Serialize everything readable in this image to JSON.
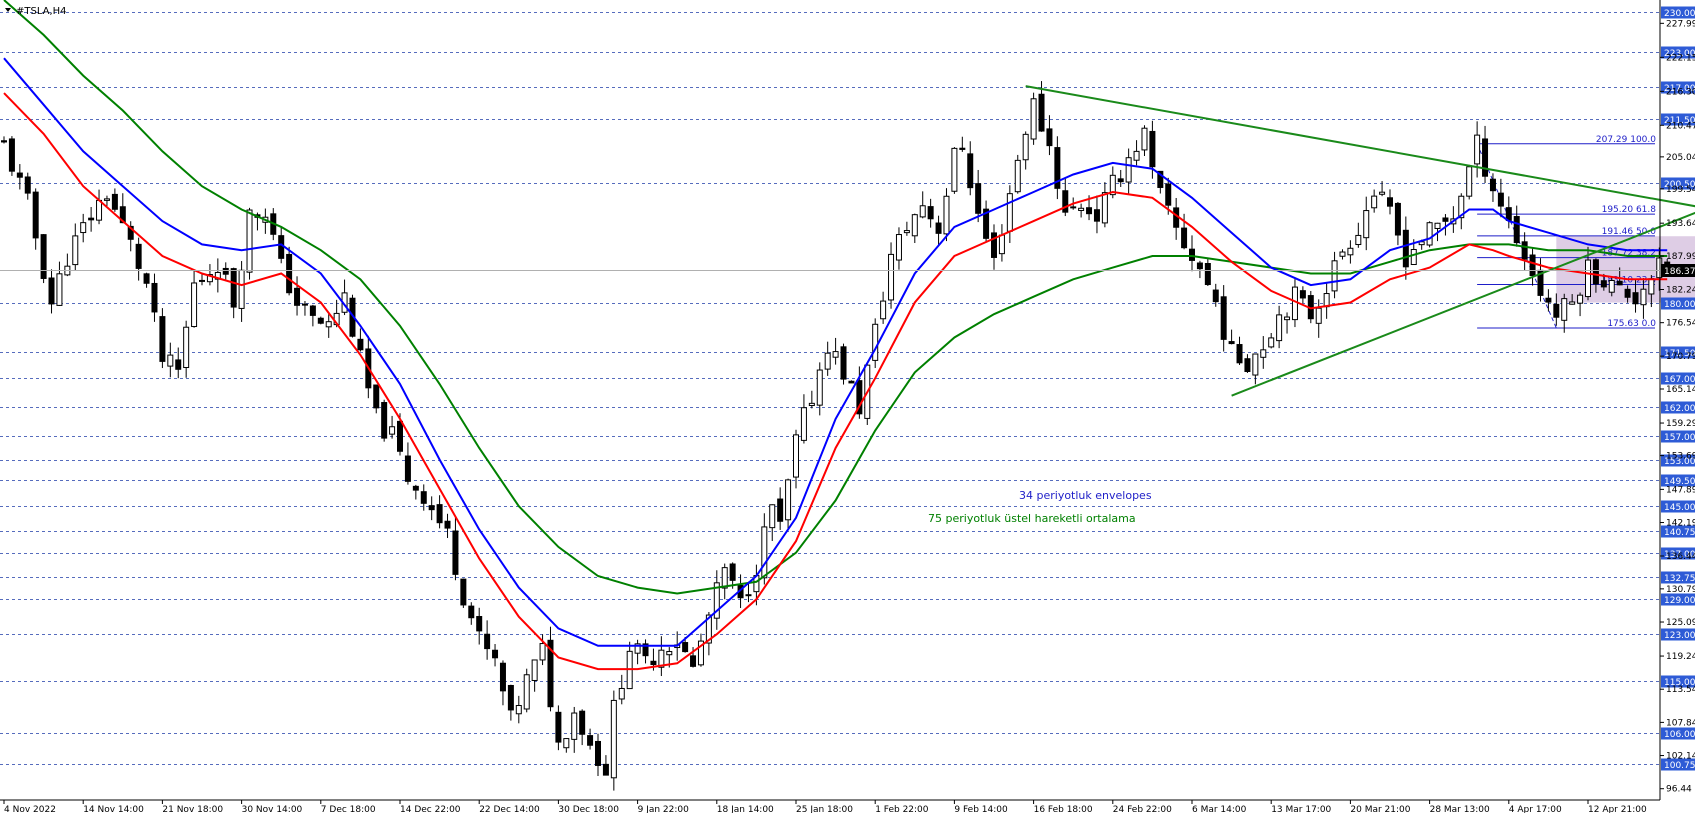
{
  "window": {
    "title": "#TSLA,H4",
    "menu_icon": "triangle-down-icon"
  },
  "price_label": "186.37",
  "annotations": {
    "envelopes": "34 periyotluk envelopes",
    "ema": "75 periyotluk üstel hareketli ortalama"
  },
  "colors": {
    "background": "#ffffff",
    "grid": "#1e3ca8",
    "axis_box": "#2e5bd6",
    "envelope_upper": "#0000ff",
    "envelope_lower": "#ff0000",
    "ema": "#008000",
    "trendline": "#1a8a1a",
    "fibo": "#1e1ec8",
    "rectangle": "#d8c4e0",
    "candles": "#000000"
  },
  "chart_data": {
    "type": "candlestick",
    "symbol": "#TSLA",
    "timeframe": "H4",
    "ylim": [
      94.5,
      232.0
    ],
    "y_ticks": [
      227.99,
      222.15,
      216.3,
      210.47,
      205.04,
      199.54,
      193.64,
      187.99,
      182.24,
      176.54,
      170.79,
      165.14,
      159.29,
      153.69,
      147.89,
      142.19,
      136.44,
      130.79,
      125.09,
      119.24,
      113.54,
      107.84,
      102.14,
      96.44
    ],
    "level_lines": [
      "230.00",
      "223.00",
      "217.00",
      "211.50",
      "200.50",
      "180.00",
      "171.50",
      "167.00",
      "162.00",
      "157.00",
      "153.00",
      "149.50",
      "145.00",
      "140.75",
      "137.00",
      "132.75",
      "129.00",
      "123.00",
      "115.00",
      "106.00",
      "100.75"
    ],
    "x_tick_labels": [
      "4 Nov 2022",
      "14 Nov 14:00",
      "21 Nov 18:00",
      "30 Nov 14:00",
      "7 Dec 18:00",
      "14 Dec 22:00",
      "22 Dec 14:00",
      "30 Dec 18:00",
      "9 Jan 22:00",
      "18 Jan 14:00",
      "25 Jan 18:00",
      "1 Feb 22:00",
      "9 Feb 14:00",
      "16 Feb 18:00",
      "24 Feb 22:00",
      "6 Mar 14:00",
      "13 Mar 17:00",
      "20 Mar 21:00",
      "28 Mar 13:00",
      "4 Apr 17:00",
      "12 Apr 21:00"
    ],
    "x_tick_index": [
      0,
      10,
      20,
      30,
      40,
      50,
      60,
      70,
      80,
      90,
      100,
      110,
      120,
      130,
      140,
      150,
      160,
      170,
      180,
      190,
      200
    ],
    "close_path": [
      [
        0,
        207
      ],
      [
        3,
        197
      ],
      [
        6,
        180
      ],
      [
        8,
        188
      ],
      [
        11,
        195
      ],
      [
        13,
        199
      ],
      [
        16,
        190
      ],
      [
        18,
        183
      ],
      [
        20,
        170
      ],
      [
        22,
        168
      ],
      [
        24,
        183
      ],
      [
        27,
        187
      ],
      [
        29,
        180
      ],
      [
        31,
        195
      ],
      [
        33,
        196
      ],
      [
        35,
        186
      ],
      [
        37,
        180
      ],
      [
        39,
        177
      ],
      [
        41,
        176
      ],
      [
        43,
        181
      ],
      [
        45,
        170
      ],
      [
        47,
        160
      ],
      [
        49,
        157
      ],
      [
        51,
        150
      ],
      [
        53,
        147
      ],
      [
        56,
        140
      ],
      [
        58,
        130
      ],
      [
        60,
        122
      ],
      [
        62,
        118
      ],
      [
        64,
        108
      ],
      [
        66,
        115
      ],
      [
        68,
        120
      ],
      [
        70,
        104
      ],
      [
        72,
        110
      ],
      [
        74,
        104
      ],
      [
        76,
        100
      ],
      [
        77,
        110
      ],
      [
        79,
        121
      ],
      [
        81,
        118
      ],
      [
        83,
        121
      ],
      [
        85,
        122
      ],
      [
        87,
        117
      ],
      [
        89,
        126
      ],
      [
        91,
        134
      ],
      [
        93,
        128
      ],
      [
        95,
        135
      ],
      [
        97,
        145
      ],
      [
        98,
        141
      ],
      [
        100,
        156
      ],
      [
        102,
        164
      ],
      [
        104,
        173
      ],
      [
        106,
        168
      ],
      [
        108,
        162
      ],
      [
        110,
        175
      ],
      [
        112,
        188
      ],
      [
        114,
        193
      ],
      [
        116,
        197
      ],
      [
        118,
        193
      ],
      [
        120,
        205
      ],
      [
        121,
        207
      ],
      [
        123,
        195
      ],
      [
        125,
        187
      ],
      [
        127,
        199
      ],
      [
        129,
        210
      ],
      [
        130,
        214
      ],
      [
        132,
        207
      ],
      [
        134,
        195
      ],
      [
        136,
        197
      ],
      [
        138,
        195
      ],
      [
        140,
        200
      ],
      [
        142,
        205
      ],
      [
        144,
        209
      ],
      [
        145,
        202
      ],
      [
        147,
        195
      ],
      [
        149,
        190
      ],
      [
        151,
        186
      ],
      [
        153,
        180
      ],
      [
        155,
        171
      ],
      [
        157,
        170
      ],
      [
        159,
        173
      ],
      [
        161,
        178
      ],
      [
        163,
        181
      ],
      [
        165,
        178
      ],
      [
        167,
        183
      ],
      [
        169,
        189
      ],
      [
        171,
        193
      ],
      [
        173,
        199
      ],
      [
        175,
        195
      ],
      [
        177,
        188
      ],
      [
        179,
        191
      ],
      [
        181,
        193
      ],
      [
        183,
        195
      ],
      [
        185,
        203
      ],
      [
        186,
        207
      ],
      [
        188,
        200
      ],
      [
        190,
        194
      ],
      [
        192,
        188
      ],
      [
        194,
        182
      ],
      [
        196,
        178
      ],
      [
        198,
        180
      ],
      [
        200,
        186
      ],
      [
        202,
        184
      ],
      [
        204,
        182
      ],
      [
        206,
        181
      ],
      [
        208,
        185
      ],
      [
        210,
        186.37
      ]
    ],
    "envelope_upper_path": [
      [
        0,
        222
      ],
      [
        5,
        214
      ],
      [
        10,
        206
      ],
      [
        15,
        200
      ],
      [
        20,
        194
      ],
      [
        25,
        190
      ],
      [
        30,
        189
      ],
      [
        35,
        190
      ],
      [
        40,
        185
      ],
      [
        45,
        176
      ],
      [
        50,
        166
      ],
      [
        55,
        153
      ],
      [
        60,
        141
      ],
      [
        65,
        131
      ],
      [
        70,
        124
      ],
      [
        75,
        121
      ],
      [
        80,
        121
      ],
      [
        85,
        121
      ],
      [
        90,
        127
      ],
      [
        95,
        133
      ],
      [
        100,
        143
      ],
      [
        105,
        160
      ],
      [
        110,
        172
      ],
      [
        115,
        185
      ],
      [
        120,
        193
      ],
      [
        125,
        196
      ],
      [
        130,
        199
      ],
      [
        135,
        202
      ],
      [
        140,
        204
      ],
      [
        145,
        203
      ],
      [
        150,
        198
      ],
      [
        155,
        192
      ],
      [
        160,
        186
      ],
      [
        165,
        183
      ],
      [
        170,
        184
      ],
      [
        175,
        189
      ],
      [
        180,
        191
      ],
      [
        185,
        196
      ],
      [
        188,
        196
      ],
      [
        190,
        194
      ],
      [
        195,
        192
      ],
      [
        200,
        190
      ],
      [
        205,
        189
      ],
      [
        210,
        189
      ]
    ],
    "envelope_lower_path": [
      [
        0,
        216
      ],
      [
        5,
        209
      ],
      [
        10,
        200
      ],
      [
        15,
        194
      ],
      [
        20,
        188
      ],
      [
        25,
        185
      ],
      [
        30,
        183
      ],
      [
        35,
        185
      ],
      [
        40,
        180
      ],
      [
        45,
        171
      ],
      [
        50,
        160
      ],
      [
        55,
        148
      ],
      [
        60,
        136
      ],
      [
        65,
        126
      ],
      [
        70,
        119
      ],
      [
        75,
        117
      ],
      [
        80,
        117
      ],
      [
        85,
        118
      ],
      [
        90,
        123
      ],
      [
        95,
        129
      ],
      [
        100,
        139
      ],
      [
        105,
        155
      ],
      [
        110,
        167
      ],
      [
        115,
        180
      ],
      [
        120,
        188
      ],
      [
        125,
        191
      ],
      [
        130,
        194
      ],
      [
        135,
        197
      ],
      [
        140,
        199
      ],
      [
        145,
        198
      ],
      [
        150,
        193
      ],
      [
        155,
        187
      ],
      [
        160,
        182
      ],
      [
        165,
        179
      ],
      [
        170,
        180
      ],
      [
        175,
        184
      ],
      [
        180,
        186
      ],
      [
        185,
        190
      ],
      [
        188,
        189
      ],
      [
        190,
        188
      ],
      [
        195,
        186
      ],
      [
        200,
        185
      ],
      [
        205,
        184
      ],
      [
        210,
        184
      ]
    ],
    "ema_path": [
      [
        0,
        232
      ],
      [
        5,
        226
      ],
      [
        10,
        219
      ],
      [
        15,
        213
      ],
      [
        20,
        206
      ],
      [
        25,
        200
      ],
      [
        30,
        196
      ],
      [
        35,
        193
      ],
      [
        40,
        189
      ],
      [
        45,
        184
      ],
      [
        50,
        176
      ],
      [
        55,
        166
      ],
      [
        60,
        155
      ],
      [
        65,
        145
      ],
      [
        70,
        138
      ],
      [
        75,
        133
      ],
      [
        80,
        131
      ],
      [
        85,
        130
      ],
      [
        90,
        131
      ],
      [
        95,
        132
      ],
      [
        100,
        137
      ],
      [
        105,
        146
      ],
      [
        110,
        158
      ],
      [
        115,
        168
      ],
      [
        120,
        174
      ],
      [
        125,
        178
      ],
      [
        130,
        181
      ],
      [
        135,
        184
      ],
      [
        140,
        186
      ],
      [
        145,
        188
      ],
      [
        150,
        188
      ],
      [
        155,
        187
      ],
      [
        160,
        186
      ],
      [
        165,
        185
      ],
      [
        170,
        185
      ],
      [
        175,
        187
      ],
      [
        180,
        189
      ],
      [
        185,
        190
      ],
      [
        190,
        190
      ],
      [
        195,
        189
      ],
      [
        200,
        189
      ],
      [
        205,
        188
      ],
      [
        210,
        188
      ]
    ],
    "fibo_levels": [
      {
        "label": "207.29 100.0",
        "price": 207.29
      },
      {
        "label": "195.20 61.8",
        "price": 195.2
      },
      {
        "label": "191.46 50.0",
        "price": 191.46
      },
      {
        "label": "187.72 38.2",
        "price": 187.72
      },
      {
        "label": "183.10 23.6",
        "price": 183.1
      },
      {
        "label": "175.63 0.0",
        "price": 175.63
      }
    ],
    "fibo_start_index": 186,
    "trendline_upper": [
      [
        129,
        217.2
      ],
      [
        215,
        196.2
      ]
    ],
    "trendline_lower": [
      [
        155,
        164.0
      ],
      [
        215,
        196.2
      ]
    ],
    "rectangle": {
      "x_from": 196,
      "x_to": 214,
      "y_from": 180,
      "y_to": 191.4
    },
    "grid": true
  }
}
